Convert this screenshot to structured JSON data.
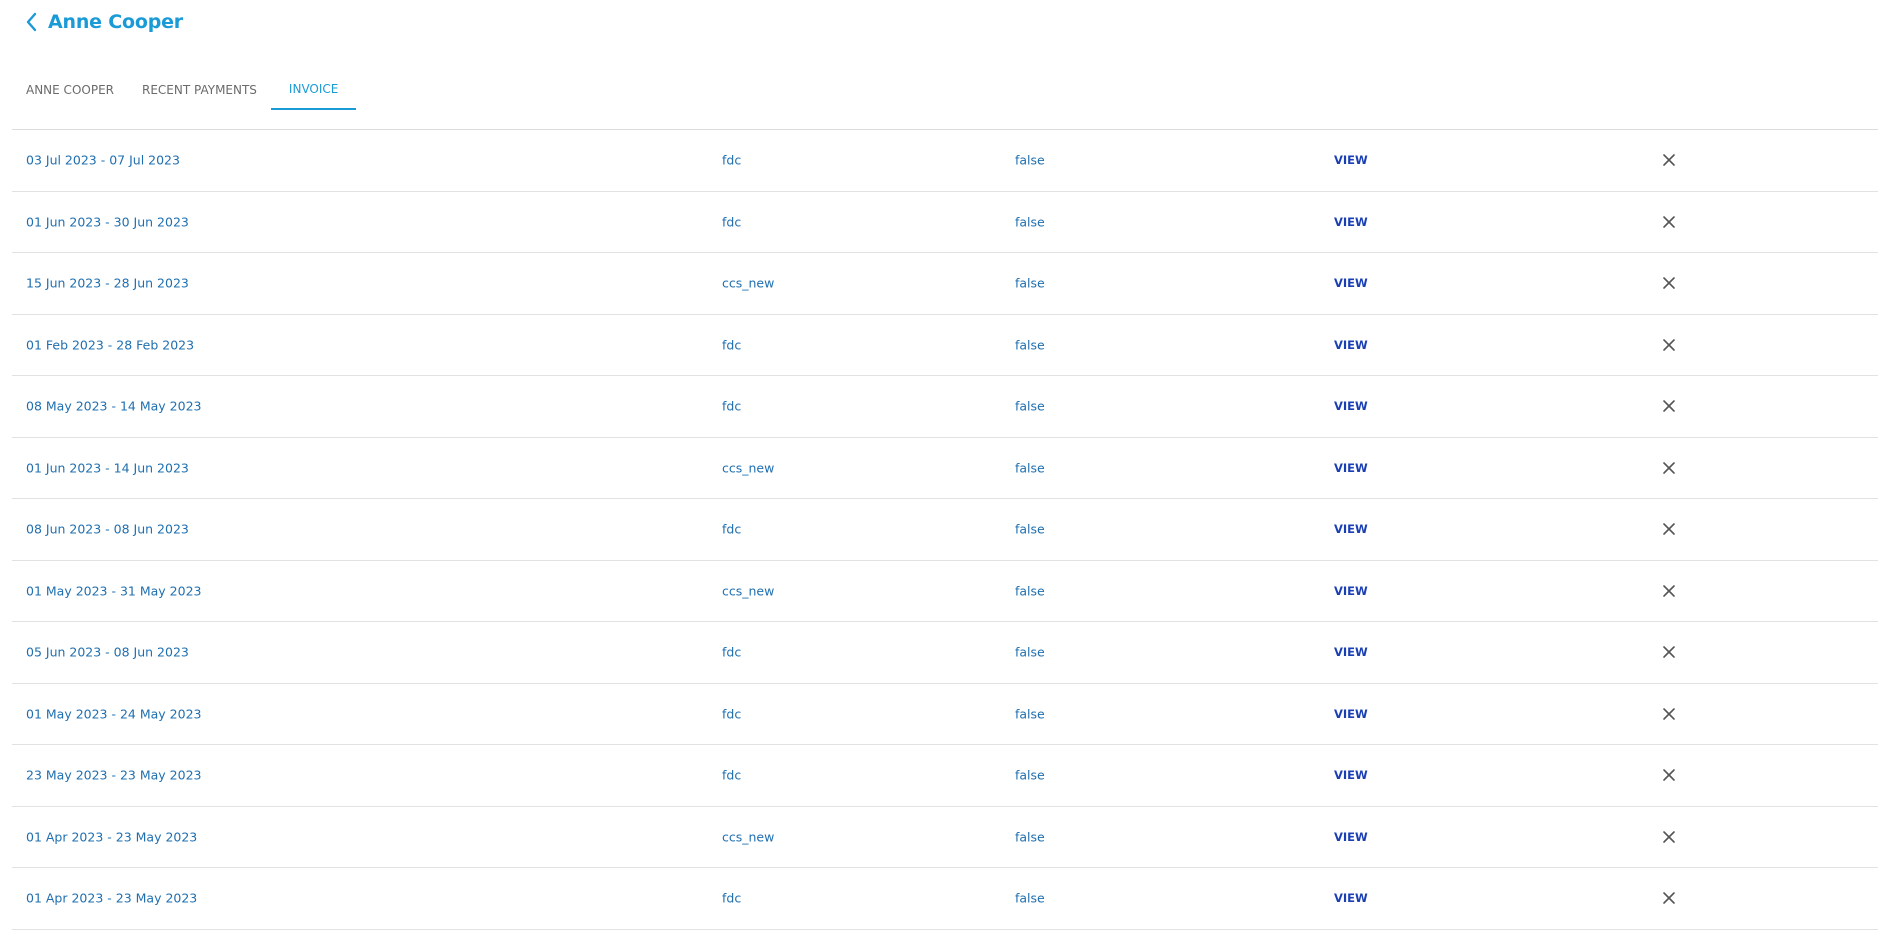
{
  "header": {
    "title": "Anne Cooper"
  },
  "tabs": [
    {
      "label": "ANNE COOPER",
      "active": false
    },
    {
      "label": "RECENT PAYMENTS",
      "active": false
    },
    {
      "label": "INVOICE",
      "active": true
    }
  ],
  "invoices": [
    {
      "period": "03 Jul 2023 - 07 Jul 2023",
      "type": "fdc",
      "flag": "false",
      "action": "VIEW"
    },
    {
      "period": "01 Jun 2023 - 30 Jun 2023",
      "type": "fdc",
      "flag": "false",
      "action": "VIEW"
    },
    {
      "period": "15 Jun 2023 - 28 Jun 2023",
      "type": "ccs_new",
      "flag": "false",
      "action": "VIEW"
    },
    {
      "period": "01 Feb 2023 - 28 Feb 2023",
      "type": "fdc",
      "flag": "false",
      "action": "VIEW"
    },
    {
      "period": "08 May 2023 - 14 May 2023",
      "type": "fdc",
      "flag": "false",
      "action": "VIEW"
    },
    {
      "period": "01 Jun 2023 - 14 Jun 2023",
      "type": "ccs_new",
      "flag": "false",
      "action": "VIEW"
    },
    {
      "period": "08 Jun 2023 - 08 Jun 2023",
      "type": "fdc",
      "flag": "false",
      "action": "VIEW"
    },
    {
      "period": "01 May 2023 - 31 May 2023",
      "type": "ccs_new",
      "flag": "false",
      "action": "VIEW"
    },
    {
      "period": "05 Jun 2023 - 08 Jun 2023",
      "type": "fdc",
      "flag": "false",
      "action": "VIEW"
    },
    {
      "period": "01 May 2023 - 24 May 2023",
      "type": "fdc",
      "flag": "false",
      "action": "VIEW"
    },
    {
      "period": "23 May 2023 - 23 May 2023",
      "type": "fdc",
      "flag": "false",
      "action": "VIEW"
    },
    {
      "period": "01 Apr 2023 - 23 May 2023",
      "type": "ccs_new",
      "flag": "false",
      "action": "VIEW"
    },
    {
      "period": "01 Apr 2023 - 23 May 2023",
      "type": "fdc",
      "flag": "false",
      "action": "VIEW"
    }
  ],
  "icons": {
    "back": "chevron-left-icon",
    "delete": "close-icon"
  },
  "colors": {
    "accent": "#1a9ad6",
    "cell_text": "#1f6fb0",
    "view_link": "#1a3fb5",
    "tab_inactive": "#6b6b6b",
    "divider": "#e2e2e2"
  }
}
